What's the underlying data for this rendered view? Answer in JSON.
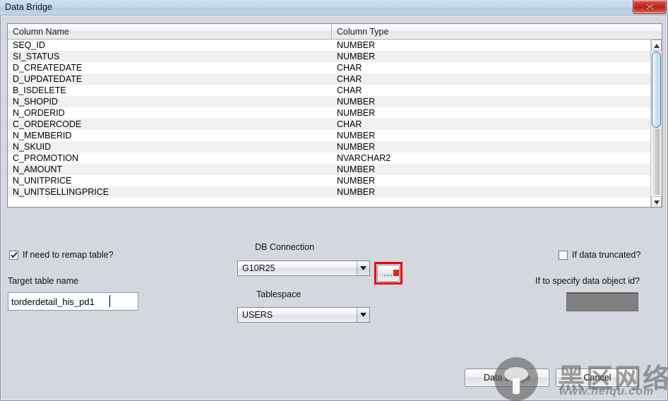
{
  "window": {
    "title": "Data Bridge",
    "close_icon": "close-x-icon"
  },
  "table": {
    "headers": [
      "Column Name",
      "Column Type"
    ],
    "rows": [
      [
        "SEQ_ID",
        "NUMBER"
      ],
      [
        "SI_STATUS",
        "NUMBER"
      ],
      [
        "D_CREATEDATE",
        "CHAR"
      ],
      [
        "D_UPDATEDATE",
        "CHAR"
      ],
      [
        "B_ISDELETE",
        "CHAR"
      ],
      [
        "N_SHOPID",
        "NUMBER"
      ],
      [
        "N_ORDERID",
        "NUMBER"
      ],
      [
        "C_ORDERCODE",
        "CHAR"
      ],
      [
        "N_MEMBERID",
        "NUMBER"
      ],
      [
        "N_SKUID",
        "NUMBER"
      ],
      [
        "C_PROMOTION",
        "NVARCHAR2"
      ],
      [
        "N_AMOUNT",
        "NUMBER"
      ],
      [
        "N_UNITPRICE",
        "NUMBER"
      ],
      [
        "N_UNITSELLINGPRICE",
        "NUMBER"
      ]
    ],
    "scrollbar": {
      "up_icon": "triangle-up-icon",
      "down_icon": "triangle-down-icon"
    }
  },
  "form": {
    "remap_checkbox_label": "If need to remap table?",
    "remap_checkbox_checked": true,
    "target_table_name_label": "Target table name",
    "target_table_name_value": "torderdetail_his_pd1",
    "db_connection_label": "DB Connection",
    "db_connection_value": "G10R25",
    "browse_button_label": "...",
    "tablespace_label": "Tablespace",
    "tablespace_value": "USERS",
    "truncated_checkbox_label": "If data truncated?",
    "truncated_checkbox_checked": false,
    "data_object_id_label": "If to specify data object id?",
    "data_object_id_value": ""
  },
  "buttons": {
    "data_bridge": "Data Bridge",
    "cancel": "Cancel"
  },
  "watermark": {
    "brand": "黑区网络",
    "url": "www.heiqu.com"
  },
  "colors": {
    "dialog_background": "#d4d7de",
    "titlebar": "#c2d7ec",
    "close_button": "#ba2018",
    "highlight_box": "#ef0000",
    "row_alt": "#f0f0f0",
    "scroll_thumb": "#bad7ef",
    "disabled_field": "#808080"
  }
}
